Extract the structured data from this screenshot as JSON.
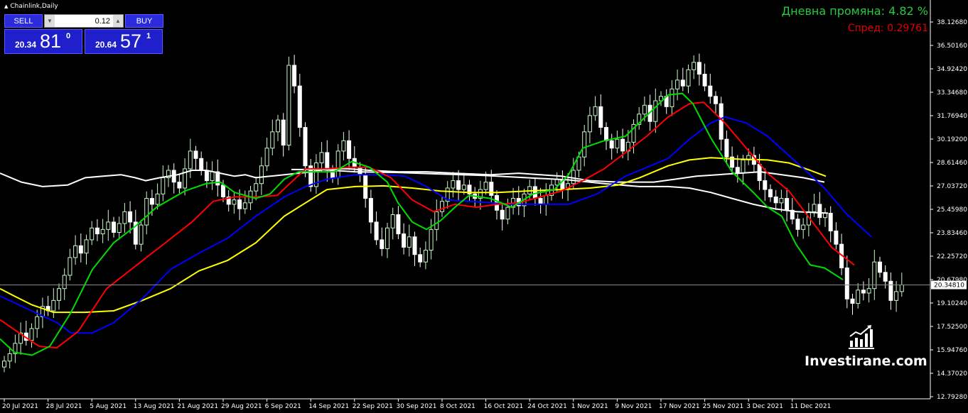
{
  "header": {
    "title": "Chainlink,Daily"
  },
  "trade_panel": {
    "sell_label": "SELL",
    "buy_label": "BUY",
    "lot_value": "0.12",
    "sell_price": {
      "prefix": "20.34",
      "big": "81",
      "sup": "0"
    },
    "buy_price": {
      "prefix": "20.64",
      "big": "57",
      "sup": "1"
    }
  },
  "info": {
    "daily_change": "Дневна промяна: 4.82 %",
    "spread": "Спред: 0.29761"
  },
  "brand": {
    "name": "Investirane.com"
  },
  "colors": {
    "background": "#000000",
    "bull_candle": "#c8f7c8",
    "bear_candle": "#ffffff",
    "ma_green": "#00dd00",
    "ma_red": "#ff0000",
    "ma_blue": "#0000ff",
    "ma_yellow": "#ffff00",
    "ma_white": "#ffffff",
    "ma_light": "#eeeeee",
    "daily_change": "#27c93f",
    "spread": "#e00000"
  },
  "chart_data": {
    "type": "candlestick",
    "ylim": [
      12.7928,
      39.5
    ],
    "y_ticks": [
      "38.12680",
      "36.50160",
      "34.92420",
      "33.34680",
      "31.76940",
      "30.19200",
      "28.61460",
      "27.03720",
      "25.45980",
      "23.83460",
      "22.25720",
      "20.67980",
      "19.10240",
      "17.52500",
      "15.94760",
      "14.37020",
      "12.79280"
    ],
    "current_price": "20.34810",
    "current_price_value": 20.3481,
    "x_labels": [
      "20 Jul 2021",
      "28 Jul 2021",
      "5 Aug 2021",
      "13 Aug 2021",
      "21 Aug 2021",
      "29 Aug 2021",
      "6 Sep 2021",
      "14 Sep 2021",
      "22 Sep 2021",
      "30 Sep 2021",
      "8 Oct 2021",
      "16 Oct 2021",
      "24 Oct 2021",
      "1 Nov 2021",
      "9 Nov 2021",
      "17 Nov 2021",
      "25 Nov 2021",
      "3 Dec 2021",
      "11 Dec 2021"
    ],
    "label_every": 8,
    "closes": [
      15.2,
      15.7,
      16.4,
      17.1,
      16.6,
      17.4,
      18.2,
      18.9,
      18.6,
      19.3,
      20.1,
      21.0,
      22.2,
      23.0,
      22.5,
      23.4,
      24.2,
      23.8,
      24.1,
      24.6,
      23.9,
      24.5,
      25.3,
      24.6,
      23.1,
      24.4,
      26.2,
      25.8,
      26.5,
      27.6,
      28.1,
      27.3,
      26.9,
      28.2,
      29.4,
      28.9,
      28.1,
      27.4,
      28.0,
      27.1,
      26.3,
      25.8,
      26.1,
      25.5,
      25.9,
      26.7,
      27.2,
      28.4,
      29.6,
      30.7,
      31.5,
      29.8,
      35.2,
      33.8,
      31.0,
      28.4,
      27.0,
      28.6,
      29.3,
      28.1,
      27.6,
      29.4,
      30.1,
      28.9,
      28.3,
      27.8,
      26.2,
      24.6,
      23.4,
      22.8,
      24.2,
      25.1,
      23.8,
      22.9,
      23.6,
      22.4,
      21.9,
      22.7,
      24.1,
      25.3,
      26.0,
      26.9,
      27.4,
      26.8,
      27.1,
      26.5,
      26.2,
      26.8,
      27.3,
      26.4,
      25.4,
      24.8,
      25.6,
      26.2,
      25.7,
      26.5,
      27.0,
      26.2,
      25.8,
      26.4,
      27.1,
      27.5,
      26.8,
      27.2,
      28.1,
      29.0,
      30.7,
      31.8,
      32.4,
      31.0,
      30.1,
      29.6,
      30.2,
      29.4,
      30.0,
      31.2,
      31.9,
      32.5,
      31.4,
      32.8,
      33.1,
      32.4,
      33.6,
      34.2,
      33.8,
      34.9,
      35.4,
      34.6,
      33.8,
      33.1,
      32.6,
      30.2,
      29.0,
      28.3,
      27.9,
      28.8,
      29.1,
      28.5,
      27.4,
      26.8,
      26.3,
      25.9,
      26.2,
      25.4,
      24.8,
      24.1,
      24.4,
      25.3,
      25.8,
      24.9,
      25.2,
      24.0,
      23.1,
      21.5,
      19.4,
      19.1,
      20.0,
      19.8,
      20.1,
      21.9,
      21.2,
      20.6,
      19.3,
      19.9,
      20.35
    ],
    "series": [
      {
        "color": "#ffffff",
        "points": [
          [
            0,
            27.9
          ],
          [
            30,
            27.3
          ],
          [
            60,
            27.0
          ],
          [
            95,
            27.1
          ],
          [
            120,
            27.6
          ],
          [
            145,
            27.7
          ],
          [
            170,
            27.8
          ],
          [
            190,
            27.6
          ],
          [
            205,
            27.4
          ],
          [
            225,
            27.6
          ],
          [
            250,
            27.8
          ],
          [
            270,
            28.1
          ],
          [
            290,
            28.1
          ],
          [
            310,
            27.9
          ],
          [
            330,
            27.7
          ],
          [
            345,
            27.8
          ],
          [
            360,
            27.6
          ],
          [
            380,
            27.7
          ],
          [
            400,
            27.8
          ],
          [
            420,
            27.9
          ],
          [
            440,
            28.0
          ],
          [
            460,
            28.2
          ],
          [
            490,
            28.2
          ],
          [
            520,
            28.1
          ],
          [
            560,
            28.0
          ],
          [
            600,
            28.0
          ],
          [
            640,
            27.9
          ],
          [
            690,
            27.8
          ],
          [
            730,
            27.9
          ],
          [
            760,
            27.8
          ],
          [
            790,
            27.7
          ],
          [
            830,
            27.4
          ],
          [
            870,
            27.3
          ],
          [
            920,
            27.3
          ],
          [
            950,
            27.5
          ],
          [
            980,
            27.7
          ],
          [
            1010,
            27.8
          ],
          [
            1040,
            27.9
          ],
          [
            1070,
            28.0
          ],
          [
            1100,
            27.8
          ],
          [
            1130,
            27.6
          ],
          [
            1160,
            27.3
          ]
        ]
      },
      {
        "color": "#ffffff",
        "points": [
          [
            410,
            28.15
          ],
          [
            450,
            28.15
          ],
          [
            500,
            28.0
          ],
          [
            560,
            27.95
          ],
          [
            620,
            27.85
          ],
          [
            680,
            27.75
          ],
          [
            740,
            27.6
          ],
          [
            800,
            27.45
          ],
          [
            850,
            27.2
          ],
          [
            900,
            27.0
          ],
          [
            940,
            27.0
          ],
          [
            970,
            26.9
          ],
          [
            1000,
            26.6
          ],
          [
            1030,
            26.2
          ],
          [
            1060,
            25.8
          ],
          [
            1090,
            25.5
          ],
          [
            1120,
            25.3
          ],
          [
            1165,
            25.2
          ]
        ]
      },
      {
        "color": "#ffff00",
        "points": [
          [
            0,
            20.1
          ],
          [
            20,
            19.6
          ],
          [
            45,
            19.0
          ],
          [
            75,
            18.5
          ],
          [
            120,
            18.5
          ],
          [
            160,
            18.6
          ],
          [
            200,
            19.3
          ],
          [
            240,
            20.1
          ],
          [
            280,
            21.3
          ],
          [
            320,
            22.0
          ],
          [
            360,
            23.2
          ],
          [
            400,
            25.0
          ],
          [
            430,
            25.9
          ],
          [
            460,
            26.8
          ],
          [
            500,
            27.0
          ],
          [
            540,
            27.05
          ],
          [
            580,
            26.9
          ],
          [
            620,
            26.7
          ],
          [
            660,
            26.6
          ],
          [
            700,
            26.6
          ],
          [
            740,
            26.7
          ],
          [
            790,
            26.8
          ],
          [
            830,
            26.9
          ],
          [
            870,
            27.1
          ],
          [
            900,
            27.6
          ],
          [
            940,
            28.4
          ],
          [
            970,
            28.8
          ],
          [
            1000,
            28.95
          ],
          [
            1040,
            28.85
          ],
          [
            1080,
            28.8
          ],
          [
            1110,
            28.6
          ],
          [
            1140,
            28.1
          ],
          [
            1162,
            27.7
          ]
        ]
      },
      {
        "color": "#0000ff",
        "points": [
          [
            0,
            19.6
          ],
          [
            40,
            18.7
          ],
          [
            80,
            17.8
          ],
          [
            100,
            17.1
          ],
          [
            130,
            17.1
          ],
          [
            160,
            17.8
          ],
          [
            200,
            19.4
          ],
          [
            240,
            21.4
          ],
          [
            280,
            22.5
          ],
          [
            320,
            23.5
          ],
          [
            360,
            25.0
          ],
          [
            400,
            26.3
          ],
          [
            430,
            27.0
          ],
          [
            460,
            27.5
          ],
          [
            500,
            27.8
          ],
          [
            540,
            27.8
          ],
          [
            570,
            27.7
          ],
          [
            600,
            27.0
          ],
          [
            630,
            26.1
          ],
          [
            660,
            26.0
          ],
          [
            690,
            25.9
          ],
          [
            720,
            25.8
          ],
          [
            760,
            25.8
          ],
          [
            800,
            25.8
          ],
          [
            840,
            26.5
          ],
          [
            880,
            27.7
          ],
          [
            910,
            28.3
          ],
          [
            940,
            28.9
          ],
          [
            970,
            30.2
          ],
          [
            1000,
            31.3
          ],
          [
            1020,
            31.7
          ],
          [
            1050,
            31.3
          ],
          [
            1080,
            30.4
          ],
          [
            1110,
            29.1
          ],
          [
            1140,
            27.8
          ],
          [
            1160,
            26.9
          ],
          [
            1190,
            25.2
          ],
          [
            1226,
            23.6
          ]
        ]
      },
      {
        "color": "#ff0000",
        "points": [
          [
            0,
            18.0
          ],
          [
            30,
            17.0
          ],
          [
            55,
            16.2
          ],
          [
            80,
            16.1
          ],
          [
            110,
            17.2
          ],
          [
            150,
            20.1
          ],
          [
            190,
            21.6
          ],
          [
            230,
            23.1
          ],
          [
            270,
            24.6
          ],
          [
            300,
            26.0
          ],
          [
            330,
            26.3
          ],
          [
            360,
            26.3
          ],
          [
            390,
            26.4
          ],
          [
            410,
            27.3
          ],
          [
            430,
            28.2
          ],
          [
            460,
            28.2
          ],
          [
            490,
            28.3
          ],
          [
            520,
            28.3
          ],
          [
            550,
            27.6
          ],
          [
            580,
            26.1
          ],
          [
            610,
            25.3
          ],
          [
            640,
            25.8
          ],
          [
            670,
            25.6
          ],
          [
            700,
            25.8
          ],
          [
            730,
            25.9
          ],
          [
            760,
            26.3
          ],
          [
            790,
            26.7
          ],
          [
            820,
            27.4
          ],
          [
            850,
            28.2
          ],
          [
            880,
            29.3
          ],
          [
            910,
            30.4
          ],
          [
            940,
            31.7
          ],
          [
            970,
            32.6
          ],
          [
            990,
            32.7
          ],
          [
            1020,
            31.3
          ],
          [
            1050,
            29.6
          ],
          [
            1080,
            27.9
          ],
          [
            1110,
            26.7
          ],
          [
            1140,
            24.8
          ],
          [
            1170,
            22.9
          ],
          [
            1202,
            21.7
          ]
        ]
      },
      {
        "color": "#00dd00",
        "points": [
          [
            0,
            16.7
          ],
          [
            20,
            15.8
          ],
          [
            45,
            15.6
          ],
          [
            70,
            16.2
          ],
          [
            100,
            18.5
          ],
          [
            130,
            21.4
          ],
          [
            160,
            23.2
          ],
          [
            190,
            24.3
          ],
          [
            220,
            25.6
          ],
          [
            260,
            26.7
          ],
          [
            290,
            27.2
          ],
          [
            310,
            27.3
          ],
          [
            330,
            26.6
          ],
          [
            360,
            26.2
          ],
          [
            380,
            26.5
          ],
          [
            400,
            27.5
          ],
          [
            420,
            28.0
          ],
          [
            440,
            28.0
          ],
          [
            470,
            28.0
          ],
          [
            495,
            28.7
          ],
          [
            520,
            28.3
          ],
          [
            545,
            27.3
          ],
          [
            560,
            25.9
          ],
          [
            580,
            24.6
          ],
          [
            600,
            24.1
          ],
          [
            620,
            24.7
          ],
          [
            640,
            25.6
          ],
          [
            660,
            26.4
          ],
          [
            690,
            26.2
          ],
          [
            720,
            25.6
          ],
          [
            750,
            26.5
          ],
          [
            780,
            26.8
          ],
          [
            800,
            27.8
          ],
          [
            820,
            29.6
          ],
          [
            850,
            30.1
          ],
          [
            880,
            30.4
          ],
          [
            910,
            31.8
          ],
          [
            940,
            33.2
          ],
          [
            960,
            33.3
          ],
          [
            975,
            32.6
          ],
          [
            1000,
            30.3
          ],
          [
            1030,
            28.0
          ],
          [
            1060,
            26.6
          ],
          [
            1080,
            25.6
          ],
          [
            1100,
            25.0
          ],
          [
            1120,
            23.1
          ],
          [
            1140,
            21.7
          ],
          [
            1160,
            21.5
          ],
          [
            1186,
            20.7
          ]
        ]
      }
    ]
  }
}
